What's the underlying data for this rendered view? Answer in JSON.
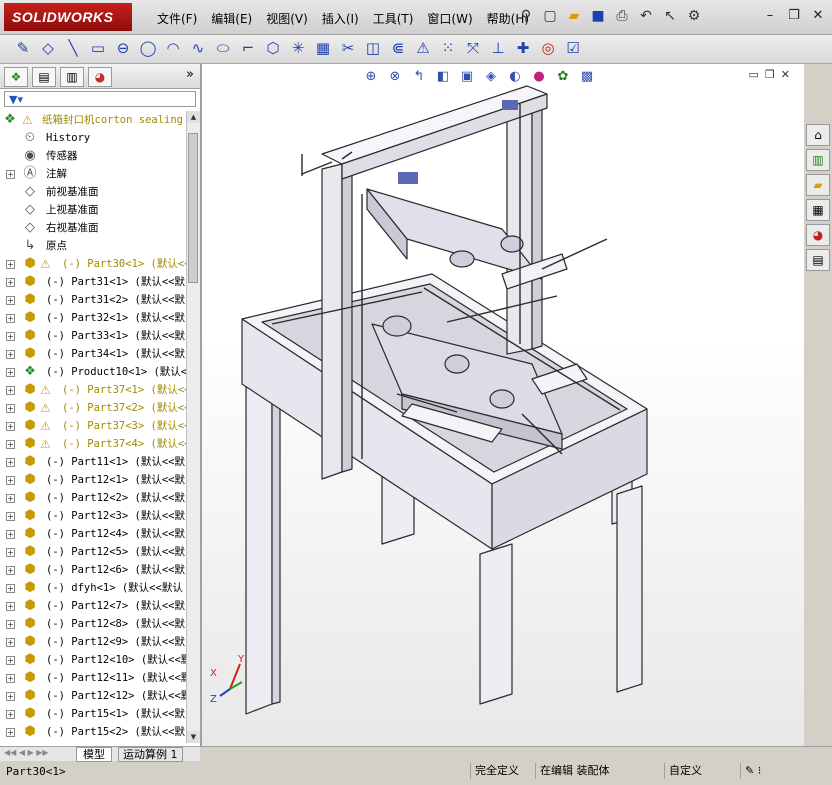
{
  "app": {
    "logo_text": "SOLIDWORKS",
    "menu": [
      "文件(F)",
      "编辑(E)",
      "视图(V)",
      "插入(I)",
      "工具(T)",
      "窗口(W)",
      "帮助(H)"
    ]
  },
  "feature_tree": {
    "root_label": "纸箱封口机corton sealing",
    "nodes": [
      {
        "label": "History",
        "icon": "history-icon",
        "warning": false
      },
      {
        "label": "传感器",
        "icon": "sensor-icon",
        "warning": false
      },
      {
        "label": "注解",
        "icon": "annotation-icon",
        "warning": false,
        "expandable": true
      },
      {
        "label": "前视基准面",
        "icon": "plane-icon",
        "warning": false
      },
      {
        "label": "上视基准面",
        "icon": "plane-icon",
        "warning": false
      },
      {
        "label": "右视基准面",
        "icon": "plane-icon",
        "warning": false
      },
      {
        "label": "原点",
        "icon": "origin-icon",
        "warning": false
      },
      {
        "label": "(-) Part30<1> (默认<<",
        "icon": "part-icon",
        "warning": true,
        "expandable": true
      },
      {
        "label": "(-) Part31<1> (默认<<默",
        "icon": "part-icon",
        "warning": false,
        "expandable": true
      },
      {
        "label": "(-) Part31<2> (默认<<默",
        "icon": "part-icon",
        "warning": false,
        "expandable": true
      },
      {
        "label": "(-) Part32<1> (默认<<默",
        "icon": "part-icon",
        "warning": false,
        "expandable": true
      },
      {
        "label": "(-) Part33<1> (默认<<默",
        "icon": "part-icon",
        "warning": false,
        "expandable": true
      },
      {
        "label": "(-) Part34<1> (默认<<默",
        "icon": "part-icon",
        "warning": false,
        "expandable": true
      },
      {
        "label": "(-) Product10<1> (默认<",
        "icon": "assembly-icon",
        "warning": false,
        "expandable": true
      },
      {
        "label": "(-) Part37<1> (默认<<",
        "icon": "part-icon",
        "warning": true,
        "expandable": true
      },
      {
        "label": "(-) Part37<2> (默认<<",
        "icon": "part-icon",
        "warning": true,
        "expandable": true
      },
      {
        "label": "(-) Part37<3> (默认<<",
        "icon": "part-icon",
        "warning": true,
        "expandable": true
      },
      {
        "label": "(-) Part37<4> (默认<<",
        "icon": "part-icon",
        "warning": true,
        "expandable": true
      },
      {
        "label": "(-) Part11<1> (默认<<默",
        "icon": "part-icon",
        "warning": false,
        "expandable": true
      },
      {
        "label": "(-) Part12<1> (默认<<默",
        "icon": "part-icon",
        "warning": false,
        "expandable": true
      },
      {
        "label": "(-) Part12<2> (默认<<默",
        "icon": "part-icon",
        "warning": false,
        "expandable": true
      },
      {
        "label": "(-) Part12<3> (默认<<默",
        "icon": "part-icon",
        "warning": false,
        "expandable": true
      },
      {
        "label": "(-) Part12<4> (默认<<默",
        "icon": "part-icon",
        "warning": false,
        "expandable": true
      },
      {
        "label": "(-) Part12<5> (默认<<默",
        "icon": "part-icon",
        "warning": false,
        "expandable": true
      },
      {
        "label": "(-) Part12<6> (默认<<默",
        "icon": "part-icon",
        "warning": false,
        "expandable": true
      },
      {
        "label": "(-) dfyh<1> (默认<<默认",
        "icon": "part-icon",
        "warning": false,
        "expandable": true
      },
      {
        "label": "(-) Part12<7> (默认<<默",
        "icon": "part-icon",
        "warning": false,
        "expandable": true
      },
      {
        "label": "(-) Part12<8> (默认<<默",
        "icon": "part-icon",
        "warning": false,
        "expandable": true
      },
      {
        "label": "(-) Part12<9> (默认<<默",
        "icon": "part-icon",
        "warning": false,
        "expandable": true
      },
      {
        "label": "(-) Part12<10> (默认<<默",
        "icon": "part-icon",
        "warning": false,
        "expandable": true
      },
      {
        "label": "(-) Part12<11> (默认<<默",
        "icon": "part-icon",
        "warning": false,
        "expandable": true
      },
      {
        "label": "(-) Part12<12> (默认<<默",
        "icon": "part-icon",
        "warning": false,
        "expandable": true
      },
      {
        "label": "(-) Part15<1> (默认<<默",
        "icon": "part-icon",
        "warning": false,
        "expandable": true
      },
      {
        "label": "(-) Part15<2> (默认<<默",
        "icon": "part-icon",
        "warning": false,
        "expandable": true
      }
    ]
  },
  "bottom_tabs": [
    "模型",
    "运动算例 1"
  ],
  "status": {
    "selection": "Part30<1>",
    "definition": "完全定义",
    "mode": "在编辑 装配体",
    "custom": "自定义"
  },
  "triad": {
    "x": "X",
    "y": "Y",
    "z": "Z"
  }
}
